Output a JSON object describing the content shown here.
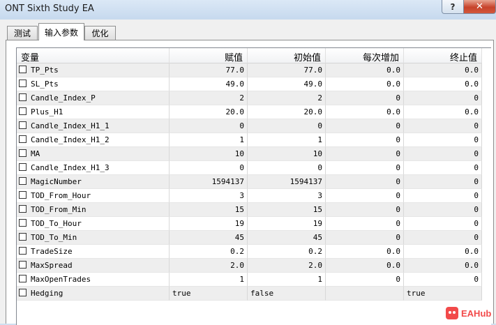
{
  "window": {
    "title": "ONT Sixth Study EA",
    "help_label": "?",
    "close_label": "✕"
  },
  "tabs": [
    {
      "label": "测试",
      "active": false
    },
    {
      "label": "输入参数",
      "active": true
    },
    {
      "label": "优化",
      "active": false
    }
  ],
  "table": {
    "columns": [
      "变量",
      "赋值",
      "初始值",
      "每次增加",
      "终止值"
    ],
    "rows": [
      [
        "TP_Pts",
        "77.0",
        "77.0",
        "0.0",
        "0.0"
      ],
      [
        "SL_Pts",
        "49.0",
        "49.0",
        "0.0",
        "0.0"
      ],
      [
        "Candle_Index_P",
        "2",
        "2",
        "0",
        "0"
      ],
      [
        "Plus_H1",
        "20.0",
        "20.0",
        "0.0",
        "0.0"
      ],
      [
        "Candle_Index_H1_1",
        "0",
        "0",
        "0",
        "0"
      ],
      [
        "Candle_Index_H1_2",
        "1",
        "1",
        "0",
        "0"
      ],
      [
        "MA",
        "10",
        "10",
        "0",
        "0"
      ],
      [
        "Candle_Index_H1_3",
        "0",
        "0",
        "0",
        "0"
      ],
      [
        "MagicNumber",
        "1594137",
        "1594137",
        "0",
        "0"
      ],
      [
        "TOD_From_Hour",
        "3",
        "3",
        "0",
        "0"
      ],
      [
        "TOD_From_Min",
        "15",
        "15",
        "0",
        "0"
      ],
      [
        "TOD_To_Hour",
        "19",
        "19",
        "0",
        "0"
      ],
      [
        "TOD_To_Min",
        "45",
        "45",
        "0",
        "0"
      ],
      [
        "TradeSize",
        "0.2",
        "0.2",
        "0.0",
        "0.0"
      ],
      [
        "MaxSpread",
        "2.0",
        "2.0",
        "0.0",
        "0.0"
      ],
      [
        "MaxOpenTrades",
        "1",
        "1",
        "0",
        "0"
      ],
      [
        "Hedging",
        "true",
        "false",
        "",
        "true"
      ]
    ]
  },
  "watermark": {
    "text": "EAHub",
    "color": "#f24a4a"
  }
}
